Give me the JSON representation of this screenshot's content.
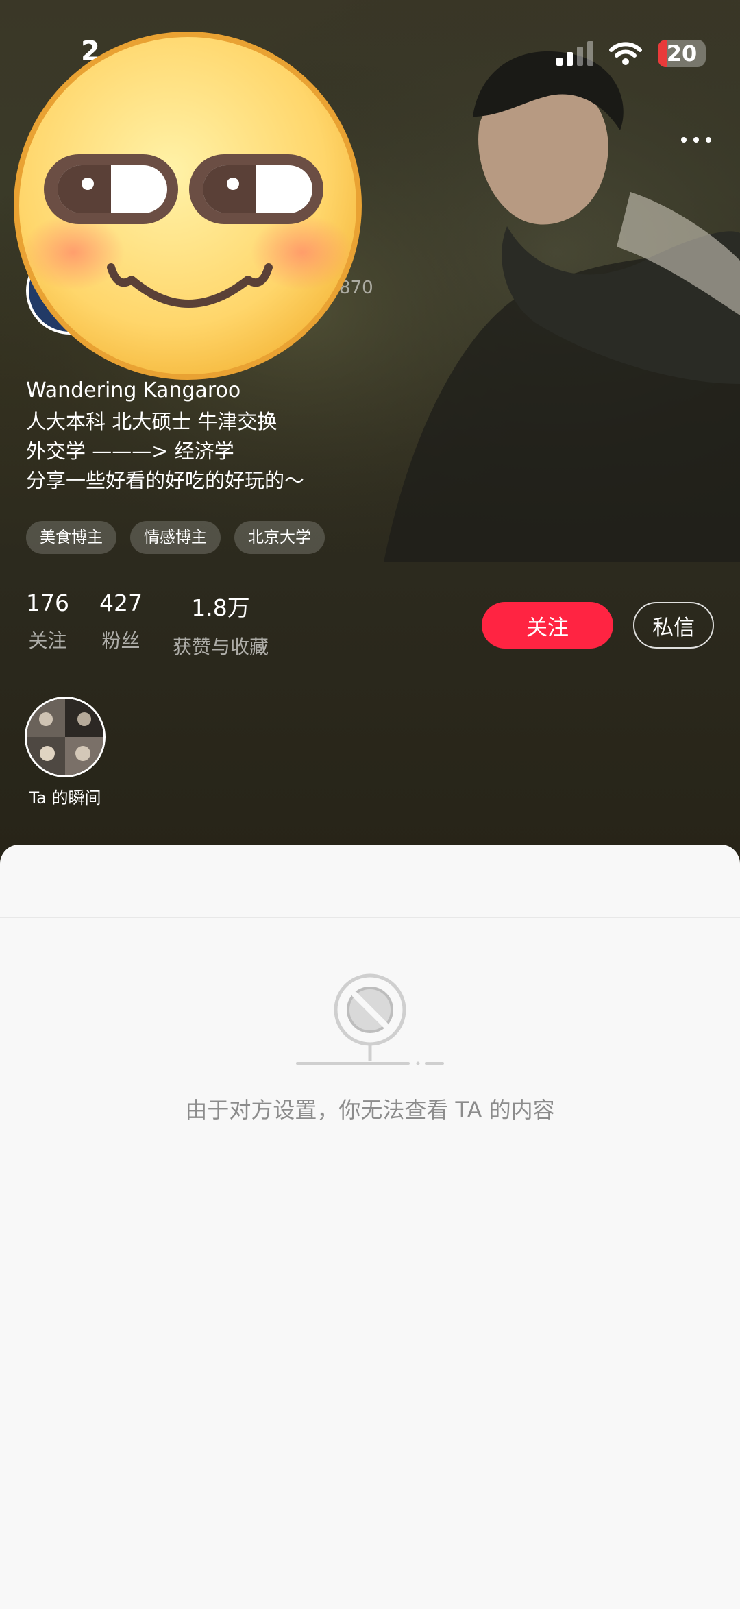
{
  "status_bar": {
    "time": "2",
    "battery_level": "20",
    "battery_fraction": 0.2
  },
  "profile": {
    "red_id_fragment": "870",
    "nickname": "Wandering Kangaroo",
    "bio_lines": [
      "人大本科 北大硕士 牛津交换",
      "外交学 ———> 经济学",
      "分享一些好看的好吃的好玩的～"
    ],
    "tags": [
      "美食博主",
      "情感博主",
      "北京大学"
    ]
  },
  "stats": [
    {
      "num": "176",
      "label": "关注"
    },
    {
      "num": "427",
      "label": "粉丝"
    },
    {
      "num": "1.8万",
      "label": "获赞与收藏"
    }
  ],
  "actions": {
    "follow": "关注",
    "message": "私信"
  },
  "moments": {
    "label": "Ta 的瞬间"
  },
  "content": {
    "empty_text": "由于对方设置，你无法查看 TA 的内容"
  },
  "colors": {
    "accent": "#ff2442",
    "header_bg": "#2c2a1e",
    "panel_bg": "#f8f8f8"
  },
  "icons": {
    "more": "more-dots-icon",
    "emoji": "smirk-emoji-sticker",
    "empty": "blocked-camera-icon"
  }
}
